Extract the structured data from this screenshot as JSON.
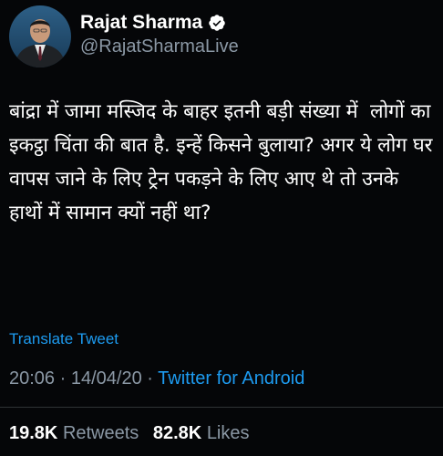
{
  "user": {
    "display_name": "Rajat Sharma",
    "handle": "@RajatSharmaLive",
    "verified": true
  },
  "tweet": {
    "text": "बांद्रा में जामा मस्जिद के बाहर इतनी बड़ी संख्या में  लोगों का इकट्ठा चिंता की बात है. इन्हें किसने बुलाया? अगर ये लोग घर वापस जाने के लिए ट्रेन पकड़ने के लिए आए थे तो उनके हाथों में सामान क्यों नहीं था?",
    "translate_label": "Translate Tweet",
    "time": "20:06",
    "date": "14/04/20",
    "separator": "·",
    "source": "Twitter for Android"
  },
  "stats": {
    "retweets_count": "19.8K",
    "retweets_label": "Retweets",
    "likes_count": "82.8K",
    "likes_label": "Likes"
  },
  "colors": {
    "background": "#050608",
    "text": "#ffffff",
    "muted": "#8b98a5",
    "accent": "#1d9bf0",
    "divider": "#2f3336"
  },
  "icons": {
    "verified": "verified-badge-icon"
  }
}
